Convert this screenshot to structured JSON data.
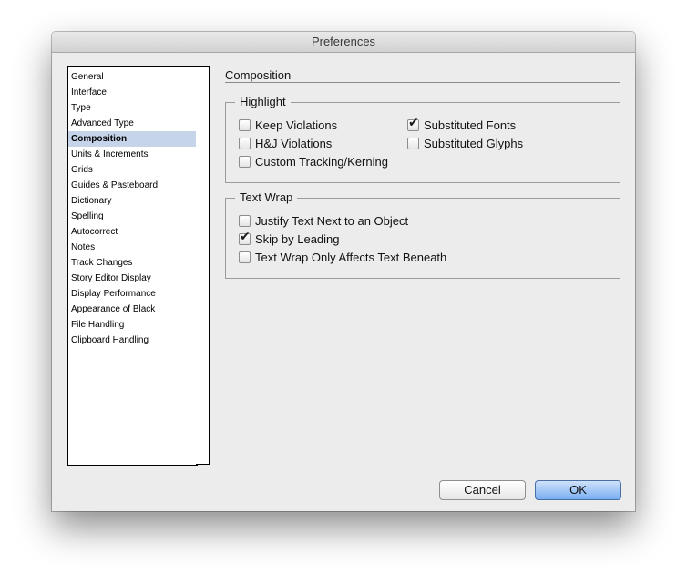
{
  "window": {
    "title": "Preferences"
  },
  "sidebar": {
    "items": [
      {
        "label": "General",
        "selected": false
      },
      {
        "label": "Interface",
        "selected": false
      },
      {
        "label": "Type",
        "selected": false
      },
      {
        "label": "Advanced Type",
        "selected": false
      },
      {
        "label": "Composition",
        "selected": true
      },
      {
        "label": "Units & Increments",
        "selected": false
      },
      {
        "label": "Grids",
        "selected": false
      },
      {
        "label": "Guides & Pasteboard",
        "selected": false
      },
      {
        "label": "Dictionary",
        "selected": false
      },
      {
        "label": "Spelling",
        "selected": false
      },
      {
        "label": "Autocorrect",
        "selected": false
      },
      {
        "label": "Notes",
        "selected": false
      },
      {
        "label": "Track Changes",
        "selected": false
      },
      {
        "label": "Story Editor Display",
        "selected": false
      },
      {
        "label": "Display Performance",
        "selected": false
      },
      {
        "label": "Appearance of Black",
        "selected": false
      },
      {
        "label": "File Handling",
        "selected": false
      },
      {
        "label": "Clipboard Handling",
        "selected": false
      }
    ]
  },
  "main": {
    "title": "Composition",
    "highlight": {
      "label": "Highlight",
      "options": {
        "keep_violations": {
          "label": "Keep Violations",
          "checked": false
        },
        "hj_violations": {
          "label": "H&J Violations",
          "checked": false
        },
        "custom_tracking": {
          "label": "Custom Tracking/Kerning",
          "checked": false
        },
        "substituted_fonts": {
          "label": "Substituted Fonts",
          "checked": true
        },
        "substituted_glyphs": {
          "label": "Substituted Glyphs",
          "checked": false
        }
      }
    },
    "text_wrap": {
      "label": "Text Wrap",
      "options": {
        "justify_text": {
          "label": "Justify Text Next to an Object",
          "checked": false
        },
        "skip_by_leading": {
          "label": "Skip by Leading",
          "checked": true
        },
        "wrap_only_beneath": {
          "label": "Text Wrap Only Affects Text Beneath",
          "checked": false
        }
      }
    }
  },
  "buttons": {
    "cancel": "Cancel",
    "ok": "OK"
  }
}
